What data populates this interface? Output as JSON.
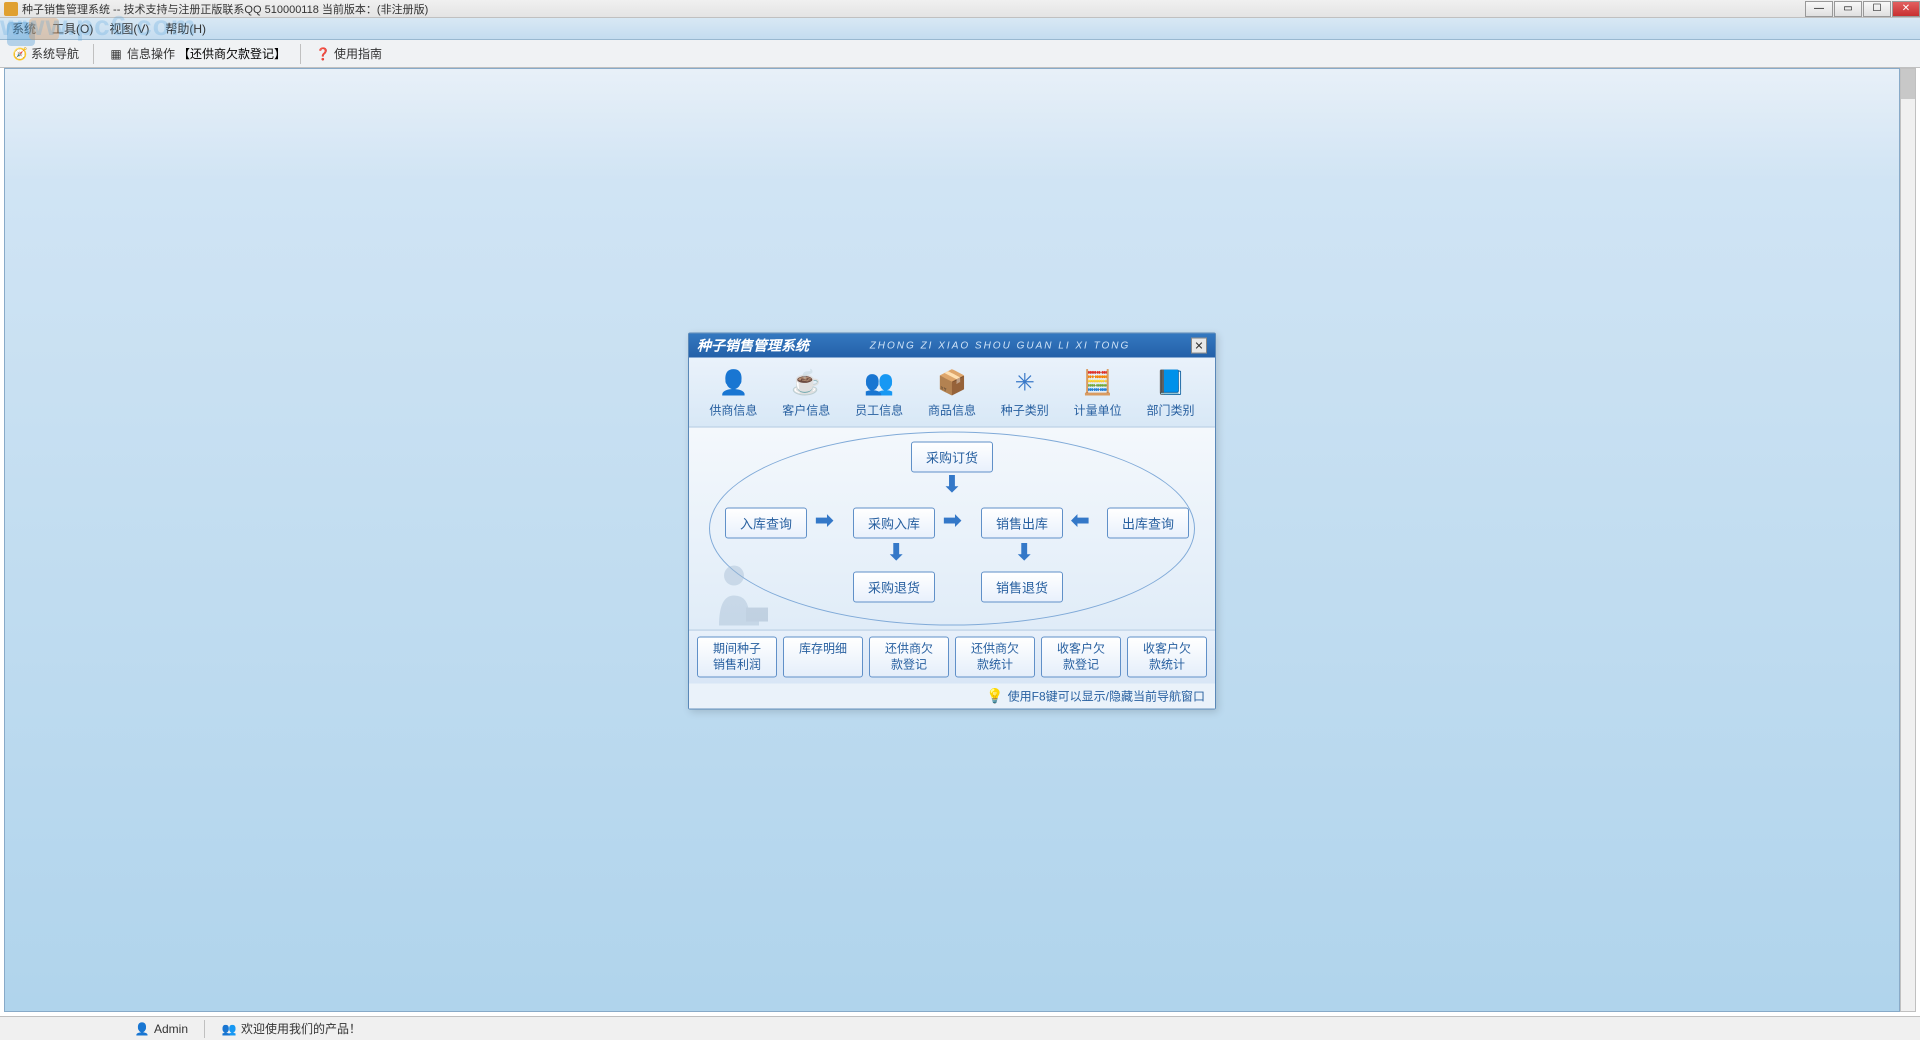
{
  "titlebar": {
    "text": "种子销售管理系统 -- 技术支持与注册正版联系QQ 510000118    当前版本：(非注册版)"
  },
  "menubar": {
    "items": [
      "系统",
      "工具(O)",
      "视图(V)",
      "帮助(H)"
    ]
  },
  "watermark": "www.pc6.com",
  "toolbar": {
    "nav": "系统导航",
    "info_ops": "信息操作",
    "current": "【还供商欠款登记】",
    "guide": "使用指南"
  },
  "nav_panel": {
    "title_cn": "种子销售管理系统",
    "title_en": "ZHONG ZI XIAO SHOU GUAN LI XI TONG",
    "icons": [
      {
        "label": "供商信息",
        "emoji": "👤"
      },
      {
        "label": "客户信息",
        "emoji": "☕"
      },
      {
        "label": "员工信息",
        "emoji": "👥"
      },
      {
        "label": "商品信息",
        "emoji": "📦"
      },
      {
        "label": "种子类别",
        "emoji": "✳"
      },
      {
        "label": "计量单位",
        "emoji": "🧮"
      },
      {
        "label": "部门类别",
        "emoji": "📘"
      }
    ],
    "flow": {
      "po": "采购订货",
      "in_query": "入库查询",
      "purchase_in": "采购入库",
      "sales_out": "销售出库",
      "out_query": "出库查询",
      "purchase_return": "采购退货",
      "sales_return": "销售退货"
    },
    "bottom_buttons": [
      "期间种子\n销售利润",
      "库存明细",
      "还供商欠\n款登记",
      "还供商欠\n款统计",
      "收客户欠\n款登记",
      "收客户欠\n款统计"
    ],
    "tip": "使用F8键可以显示/隐藏当前导航窗口"
  },
  "statusbar": {
    "user": "Admin",
    "welcome": "欢迎使用我们的产品！"
  }
}
